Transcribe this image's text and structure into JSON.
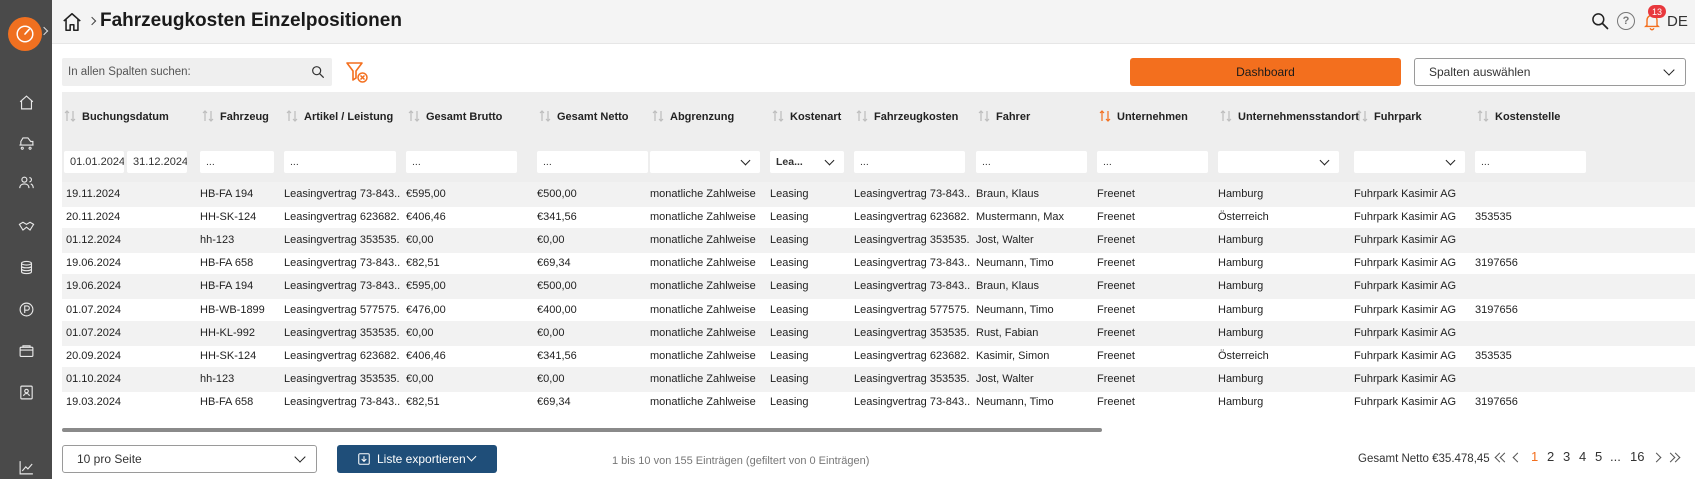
{
  "header": {
    "title": "Fahrzeugkosten Einzelpositionen",
    "language": "DE",
    "notifications_count": "13"
  },
  "toolbar": {
    "search_placeholder": "In allen Spalten suchen:",
    "dashboard_label": "Dashboard",
    "columns_select_label": "Spalten auswählen"
  },
  "colors": {
    "accent": "#f36f1e",
    "sidebar": "#4a4a4a",
    "export_button": "#1f4e79"
  },
  "table": {
    "columns": [
      {
        "label": "Buchungsdatum",
        "sorted": false
      },
      {
        "label": "Fahrzeug",
        "sorted": false
      },
      {
        "label": "Artikel / Leistung",
        "sorted": false
      },
      {
        "label": "Gesamt Brutto",
        "sorted": false
      },
      {
        "label": "Gesamt Netto",
        "sorted": false
      },
      {
        "label": "Abgrenzung",
        "sorted": false
      },
      {
        "label": "Kostenart",
        "sorted": false
      },
      {
        "label": "Fahrzeugkosten",
        "sorted": false
      },
      {
        "label": "Fahrer",
        "sorted": false
      },
      {
        "label": "Unternehmen",
        "sorted": true
      },
      {
        "label": "Unternehmensstandort",
        "sorted": false
      },
      {
        "label": "Fuhrpark",
        "sorted": false
      },
      {
        "label": "Kostenstelle",
        "sorted": false
      }
    ],
    "filters": {
      "date_from": "01.01.2024",
      "date_to": "31.12.2024",
      "text_placeholder": "...",
      "kostenart_value": "Lea..."
    },
    "rows": [
      [
        "19.11.2024",
        "HB-FA 194",
        "Leasingvertrag 73-843...",
        "€595,00",
        "€500,00",
        "monatliche Zahlweise",
        "Leasing",
        "Leasingvertrag 73-843...",
        "Braun, Klaus",
        "Freenet",
        "Hamburg",
        "Fuhrpark Kasimir AG",
        ""
      ],
      [
        "20.11.2024",
        "HH-SK-124",
        "Leasingvertrag 623682...",
        "€406,46",
        "€341,56",
        "monatliche Zahlweise",
        "Leasing",
        "Leasingvertrag 623682...",
        "Mustermann, Max",
        "Freenet",
        "Österreich",
        "Fuhrpark Kasimir AG",
        "353535"
      ],
      [
        "01.12.2024",
        "hh-123",
        "Leasingvertrag 353535...",
        "€0,00",
        "€0,00",
        "monatliche Zahlweise",
        "Leasing",
        "Leasingvertrag 353535...",
        "Jost, Walter",
        "Freenet",
        "Hamburg",
        "Fuhrpark Kasimir AG",
        ""
      ],
      [
        "19.06.2024",
        "HB-FA 658",
        "Leasingvertrag 73-843...",
        "€82,51",
        "€69,34",
        "monatliche Zahlweise",
        "Leasing",
        "Leasingvertrag 73-843...",
        "Neumann, Timo",
        "Freenet",
        "Hamburg",
        "Fuhrpark Kasimir AG",
        "3197656"
      ],
      [
        "19.06.2024",
        "HB-FA 194",
        "Leasingvertrag 73-843...",
        "€595,00",
        "€500,00",
        "monatliche Zahlweise",
        "Leasing",
        "Leasingvertrag 73-843...",
        "Braun, Klaus",
        "Freenet",
        "Hamburg",
        "Fuhrpark Kasimir AG",
        ""
      ],
      [
        "01.07.2024",
        "HB-WB-1899",
        "Leasingvertrag 577575...",
        "€476,00",
        "€400,00",
        "monatliche Zahlweise",
        "Leasing",
        "Leasingvertrag 577575...",
        "Neumann, Timo",
        "Freenet",
        "Hamburg",
        "Fuhrpark Kasimir AG",
        "3197656"
      ],
      [
        "01.07.2024",
        "HH-KL-992",
        "Leasingvertrag 353535...",
        "€0,00",
        "€0,00",
        "monatliche Zahlweise",
        "Leasing",
        "Leasingvertrag 353535...",
        "Rust, Fabian",
        "Freenet",
        "Hamburg",
        "Fuhrpark Kasimir AG",
        ""
      ],
      [
        "20.09.2024",
        "HH-SK-124",
        "Leasingvertrag 623682...",
        "€406,46",
        "€341,56",
        "monatliche Zahlweise",
        "Leasing",
        "Leasingvertrag 623682...",
        "Kasimir, Simon",
        "Freenet",
        "Österreich",
        "Fuhrpark Kasimir AG",
        "353535"
      ],
      [
        "01.10.2024",
        "hh-123",
        "Leasingvertrag 353535...",
        "€0,00",
        "€0,00",
        "monatliche Zahlweise",
        "Leasing",
        "Leasingvertrag 353535...",
        "Jost, Walter",
        "Freenet",
        "Hamburg",
        "Fuhrpark Kasimir AG",
        ""
      ],
      [
        "19.03.2024",
        "HB-FA 658",
        "Leasingvertrag 73-843...",
        "€82,51",
        "€69,34",
        "monatliche Zahlweise",
        "Leasing",
        "Leasingvertrag 73-843...",
        "Neumann, Timo",
        "Freenet",
        "Hamburg",
        "Fuhrpark Kasimir AG",
        "3197656"
      ]
    ]
  },
  "footer": {
    "per_page_label": "10 pro Seite",
    "export_label": "Liste exportieren",
    "info_text": "1 bis 10 von 155 Einträgen (gefiltert von 0 Einträgen)",
    "total_label": "Gesamt Netto €35.478,45",
    "pages": [
      "1",
      "2",
      "3",
      "4",
      "5",
      "...",
      "16"
    ],
    "active_page": "1"
  }
}
